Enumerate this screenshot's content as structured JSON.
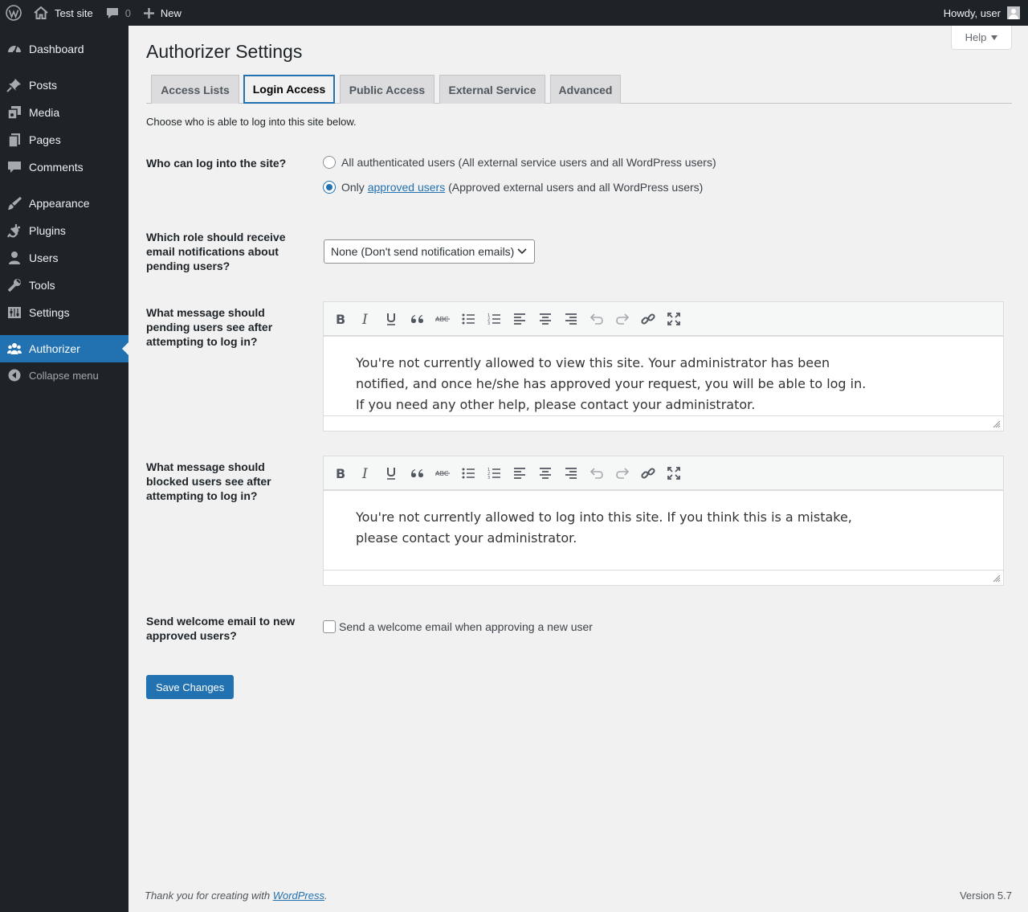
{
  "adminbar": {
    "site_name": "Test site",
    "comments_count": "0",
    "new_label": "New",
    "greeting": "Howdy, user"
  },
  "sidebar": {
    "items": [
      {
        "label": "Dashboard",
        "icon": "dashboard-icon"
      },
      {
        "label": "Posts",
        "icon": "pin-icon"
      },
      {
        "label": "Media",
        "icon": "media-icon"
      },
      {
        "label": "Pages",
        "icon": "pages-icon"
      },
      {
        "label": "Comments",
        "icon": "comment-icon"
      },
      {
        "label": "Appearance",
        "icon": "brush-icon"
      },
      {
        "label": "Plugins",
        "icon": "plug-icon"
      },
      {
        "label": "Users",
        "icon": "user-icon"
      },
      {
        "label": "Tools",
        "icon": "wrench-icon"
      },
      {
        "label": "Settings",
        "icon": "settings-icon"
      },
      {
        "label": "Authorizer",
        "icon": "groups-icon",
        "current": true
      }
    ],
    "collapse_label": "Collapse menu"
  },
  "header": {
    "help_label": "Help",
    "title": "Authorizer Settings"
  },
  "tabs": [
    {
      "label": "Access Lists"
    },
    {
      "label": "Login Access",
      "active": true
    },
    {
      "label": "Public Access"
    },
    {
      "label": "External Service"
    },
    {
      "label": "Advanced"
    }
  ],
  "intro": "Choose who is able to log into this site below.",
  "who_can_login": {
    "label": "Who can log into the site?",
    "option_all": "All authenticated users (All external service users and all WordPress users)",
    "option_only_prefix": "Only",
    "option_only_link": "approved users",
    "option_only_suffix": "(Approved external users and all WordPress users)",
    "selected": "approved"
  },
  "notify_role": {
    "label": "Which role should receive email notifications about pending users?",
    "selected_value": "None (Don't send notification emails)"
  },
  "pending_message": {
    "label": "What message should pending users see after attempting to log in?",
    "text": "You're not currently allowed to view this site. Your administrator has been\nnotified, and once he/she has approved your request, you will be able to log in.\nIf you need any other help, please contact your administrator."
  },
  "blocked_message": {
    "label": "What message should blocked users see after attempting to log in?",
    "text": "You're not currently allowed to log into this site. If you think this is a mistake,\nplease contact your administrator."
  },
  "welcome_email": {
    "label": "Send welcome email to new approved users?",
    "checkbox_label": "Send a welcome email when approving a new user",
    "checked": false
  },
  "save_label": "Save Changes",
  "footer": {
    "thanks_prefix": "Thank you for creating with",
    "thanks_link": "WordPress",
    "thanks_suffix": ".",
    "version": "Version 5.7"
  },
  "colors": {
    "accent": "#2271b1",
    "sidebar_bg": "#1d2327",
    "page_bg": "#f1f1f1"
  }
}
